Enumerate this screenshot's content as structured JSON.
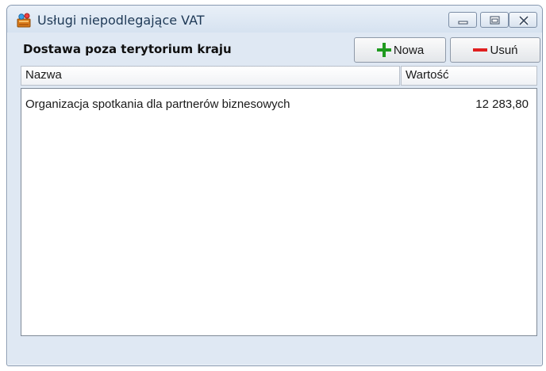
{
  "window": {
    "title": "Usługi niepodlegające VAT",
    "controls": {
      "minimize": "minimize-icon",
      "maximize": "maximize-icon",
      "close": "close-icon"
    }
  },
  "header": {
    "title": "Dostawa poza terytorium kraju"
  },
  "toolbar": {
    "new_label": "Nowa",
    "new_icon": "plus-icon",
    "new_icon_color": "#1f9a1f",
    "delete_label": "Usuń",
    "delete_icon": "minus-icon",
    "delete_icon_color": "#e02020"
  },
  "table": {
    "columns": [
      "Nazwa",
      "Wartość"
    ],
    "rows": [
      {
        "name": "Organizacja spotkania dla partnerów biznesowych",
        "value": "12 283,80"
      }
    ]
  }
}
